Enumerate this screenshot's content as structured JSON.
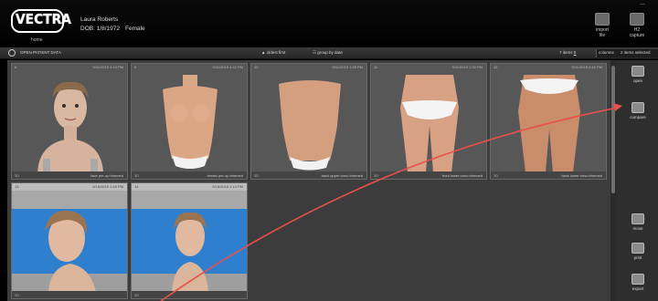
{
  "app": {
    "logo_text": "VECTRA",
    "home_label": "home",
    "minimize": "—"
  },
  "patient": {
    "name": "Laura Roberts",
    "dob": "DOB: 1/8/1972",
    "gender": "Female"
  },
  "toolbar": {
    "import_label_1": "import",
    "import_label_2": "file",
    "capture_label_1": "H2",
    "capture_label_2": "capture"
  },
  "subbar": {
    "open_patient": "OPEN PATIENT DATA",
    "oldest_first": "oldest first",
    "group_by_date": "group by date",
    "items": "7 items",
    "columns_value": "5",
    "columns_label": "columns",
    "selected": "2 items selected"
  },
  "tiles": [
    {
      "num": "8",
      "date": "9/11/2015 4:13 PM",
      "type": "3D",
      "caption": "face pre-op trimmed",
      "kind": "face"
    },
    {
      "num": "9",
      "date": "9/11/2015 4:22 PM",
      "type": "3D",
      "caption": "breast pre-op trimmed",
      "kind": "torso-front"
    },
    {
      "num": "10",
      "date": "9/11/2015 1:28 PM",
      "type": "3D",
      "caption": "back upper torso trimmed",
      "kind": "torso-back"
    },
    {
      "num": "11",
      "date": "9/11/2015 1:30 PM",
      "type": "3D",
      "caption": "front lower torso trimmed",
      "kind": "hips-front"
    },
    {
      "num": "12",
      "date": "9/11/2015 4:40 PM",
      "type": "3D",
      "caption": "back lower torso trimmed",
      "kind": "hips-back"
    },
    {
      "num": "13",
      "date": "9/16/2015 1:28 PM",
      "type": "2D",
      "caption": "",
      "kind": "face-blue-left"
    },
    {
      "num": "14",
      "date": "9/16/2015 1:14 PM",
      "type": "2D",
      "caption": "",
      "kind": "face-blue-front"
    }
  ],
  "rail": {
    "open": "open",
    "compare": "compare",
    "move": "move",
    "print": "print",
    "export": "export"
  },
  "colors": {
    "arrow": "#e8504a",
    "blue_backdrop": "#2f7fcf"
  }
}
